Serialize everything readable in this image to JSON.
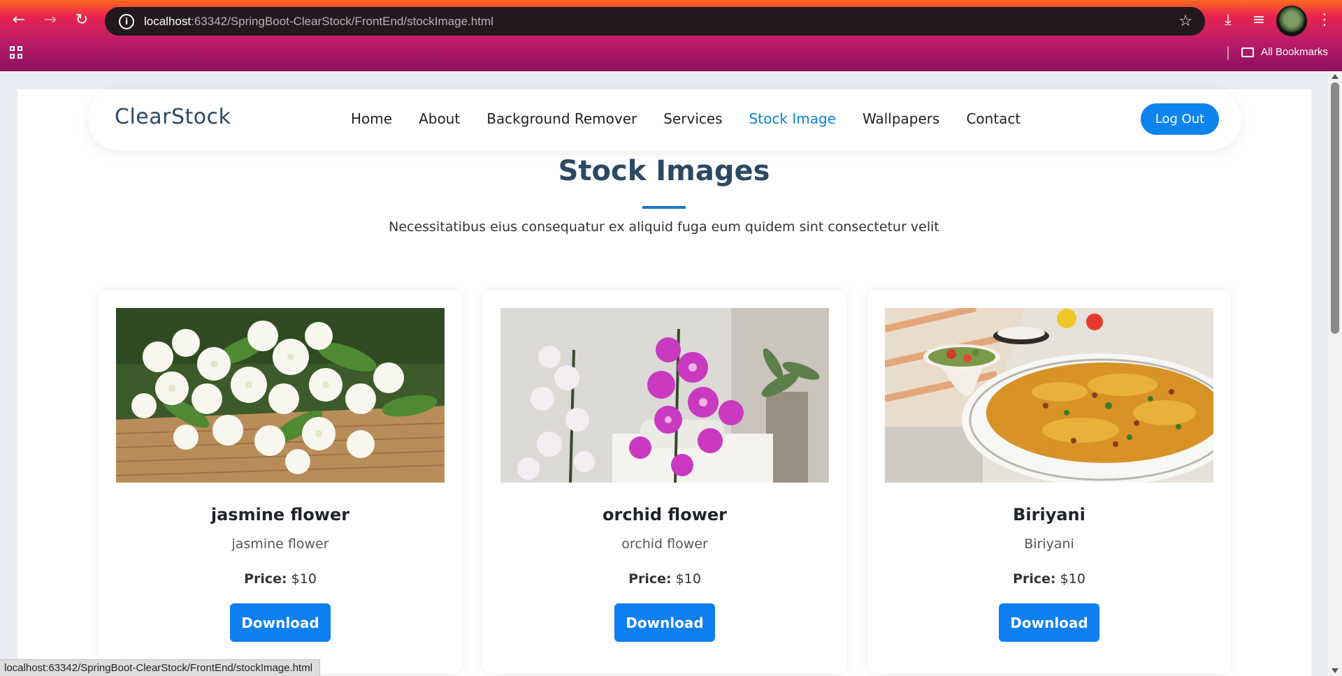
{
  "browser": {
    "url_host": "localhost",
    "url_rest": ":63342/SpringBoot-ClearStock/FrontEnd/stockImage.html",
    "bookmarks_label": "All Bookmarks",
    "status_url": "localhost:63342/SpringBoot-ClearStock/FrontEnd/stockImage.html"
  },
  "navbar": {
    "brand": "ClearStock",
    "items": [
      {
        "label": "Home",
        "active": false
      },
      {
        "label": "About",
        "active": false
      },
      {
        "label": "Background Remover",
        "active": false
      },
      {
        "label": "Services",
        "active": false
      },
      {
        "label": "Stock Image",
        "active": true
      },
      {
        "label": "Wallpapers",
        "active": false
      },
      {
        "label": "Contact",
        "active": false
      }
    ],
    "logout_label": "Log Out"
  },
  "section": {
    "title": "Stock Images",
    "subtitle": "Necessitatibus eius consequatur ex aliquid fuga eum quidem sint consectetur velit"
  },
  "cards": [
    {
      "title": "jasmine flower",
      "description": "jasmine flower",
      "price_label": "Price:",
      "price": "$10",
      "button": "Download",
      "image": "jasmine-flower-photo"
    },
    {
      "title": "orchid flower",
      "description": "orchid flower",
      "price_label": "Price:",
      "price": "$10",
      "button": "Download",
      "image": "orchid-flower-photo"
    },
    {
      "title": "Biriyani",
      "description": "Biriyani",
      "price_label": "Price:",
      "price": "$10",
      "button": "Download",
      "image": "biriyani-photo"
    }
  ],
  "colors": {
    "accent": "#0d83ee",
    "heading": "#2c4964",
    "active_link": "#0d83d6"
  }
}
